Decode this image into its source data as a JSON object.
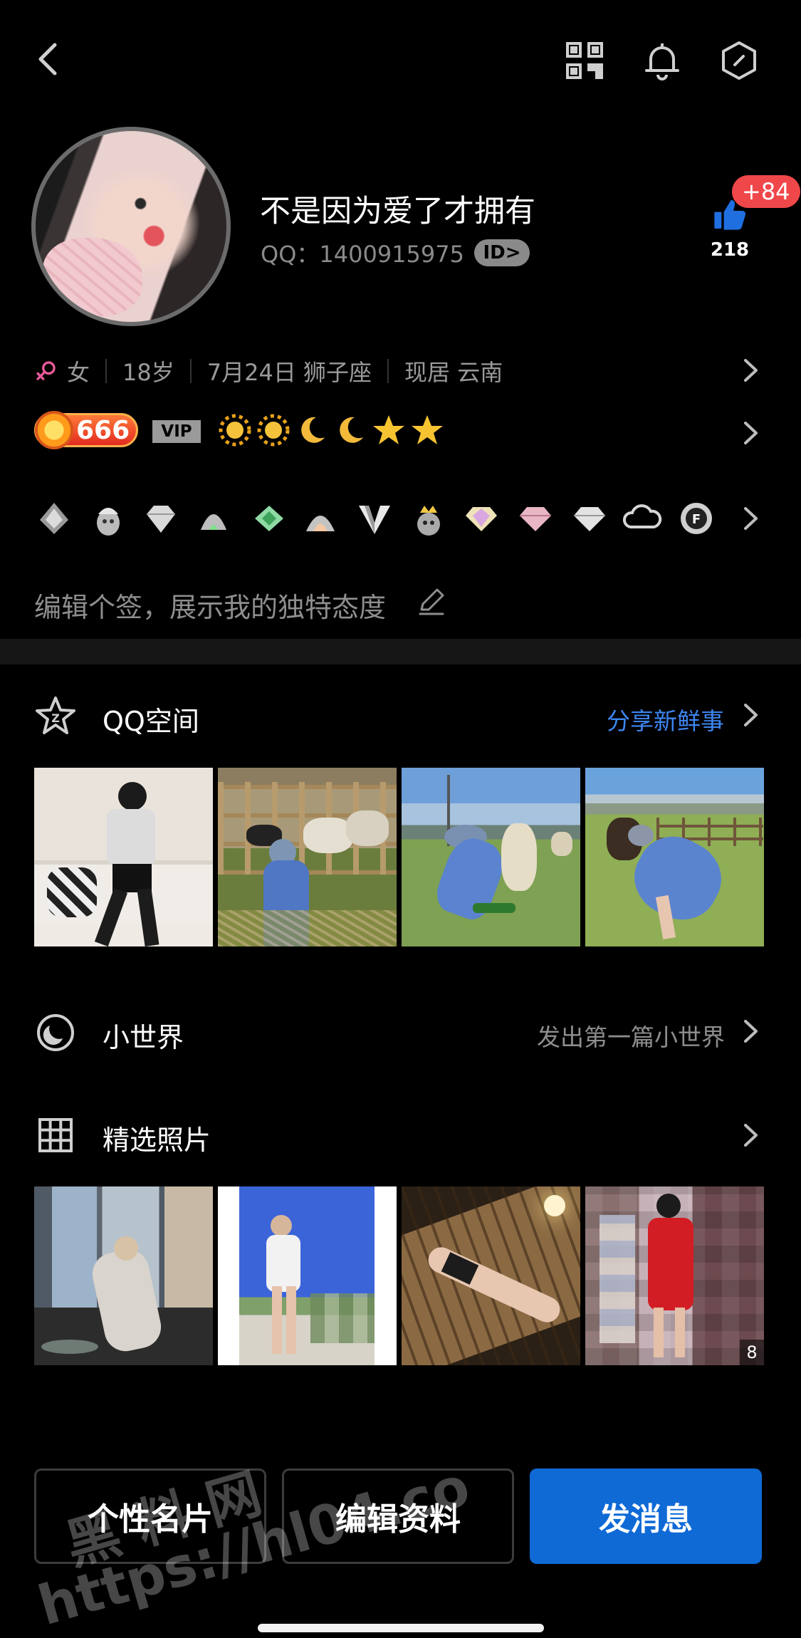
{
  "header": {
    "back_icon": "chevron-left-icon",
    "qr_icon": "qr-code-icon",
    "bell_icon": "bell-icon",
    "settings_icon": "hexagon-settings-icon"
  },
  "profile": {
    "nickname": "不是因为爱了才拥有",
    "qq_label": "QQ：1400915975",
    "id_badge": "ID>",
    "likes_increment": "+84",
    "likes_count": "218"
  },
  "info": {
    "gender": "女",
    "age": "18岁",
    "birthday": "7月24日 狮子座",
    "location": "现居 云南"
  },
  "level": {
    "number": "666",
    "vip": "VIP",
    "icons": [
      "sun",
      "sun",
      "moon",
      "moon",
      "star",
      "star"
    ]
  },
  "badges": [
    "badge-silver-wing",
    "badge-penguin-helmet",
    "badge-diamond",
    "badge-penguin-green",
    "badge-green-gem",
    "badge-penguin-rocket",
    "badge-v",
    "badge-penguin-crown",
    "badge-diamond-gold",
    "badge-diamond-pink",
    "badge-diamond-silver",
    "badge-cloud",
    "badge-game-ring"
  ],
  "signature": {
    "placeholder": "编辑个签，展示我的独特态度"
  },
  "qzone": {
    "title": "QQ空间",
    "link": "分享新鲜事",
    "link_color": "#3d86f0"
  },
  "small_world": {
    "title": "小世界",
    "link": "发出第一篇小世界"
  },
  "featured_photos": {
    "title": "精选照片",
    "count": "8"
  },
  "actions": {
    "profile_card": "个性名片",
    "edit_profile": "编辑资料",
    "send_message": "发消息"
  },
  "watermark": {
    "line1": "黑 料 网",
    "line2": "https://hl04.co"
  },
  "colors": {
    "accent": "#0f6ad6",
    "like_badge": "#f0474a",
    "link_blue": "#3d86f0"
  }
}
